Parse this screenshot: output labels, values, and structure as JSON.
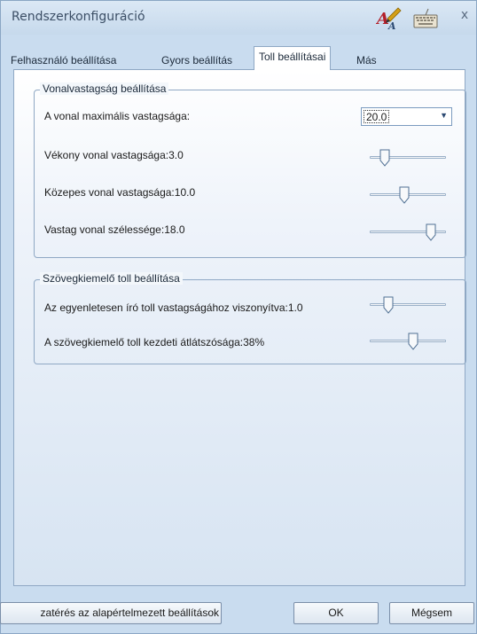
{
  "window": {
    "title": "Rendszerkonfiguráció",
    "icons": [
      "handwriting-pen-icon",
      "keyboard-icon",
      "close-icon"
    ],
    "close_label": "x"
  },
  "tabs": [
    {
      "label": "Felhasználó beállítása",
      "active": false
    },
    {
      "label": "Gyors beállítás",
      "active": false
    },
    {
      "label": "Toll beállításai",
      "active": true
    },
    {
      "label": "Más",
      "active": false
    }
  ],
  "line_width_group": {
    "title": "Vonalvastagság beállítása",
    "max_width_label": "A vonal maximális vastagsága:",
    "max_width_value": "20.0",
    "thin_label": "Vékony vonal vastagsága:3.0",
    "thin_slider": 0.15,
    "medium_label": "Közepes vonal vastagsága:10.0",
    "medium_slider": 0.45,
    "thick_label": "Vastag vonal szélessége:18.0",
    "thick_slider": 0.85
  },
  "highlighter_group": {
    "title": "Szövegkiemelő toll beállítása",
    "ratio_label": "Az egyenletesen író toll vastagságához viszonyítva:1.0",
    "ratio_slider": 0.2,
    "opacity_label": "A szövegkiemelő toll kezdeti átlátszósága:38%",
    "opacity_slider": 0.58
  },
  "buttons": {
    "reset": "zatérés az alapértelmezett beállítások",
    "ok": "OK",
    "cancel": "Mégsem"
  },
  "colors": {
    "window_bg": "#c9dcef",
    "accent": "#2c4a72",
    "pen_icon": "#d4a017"
  }
}
